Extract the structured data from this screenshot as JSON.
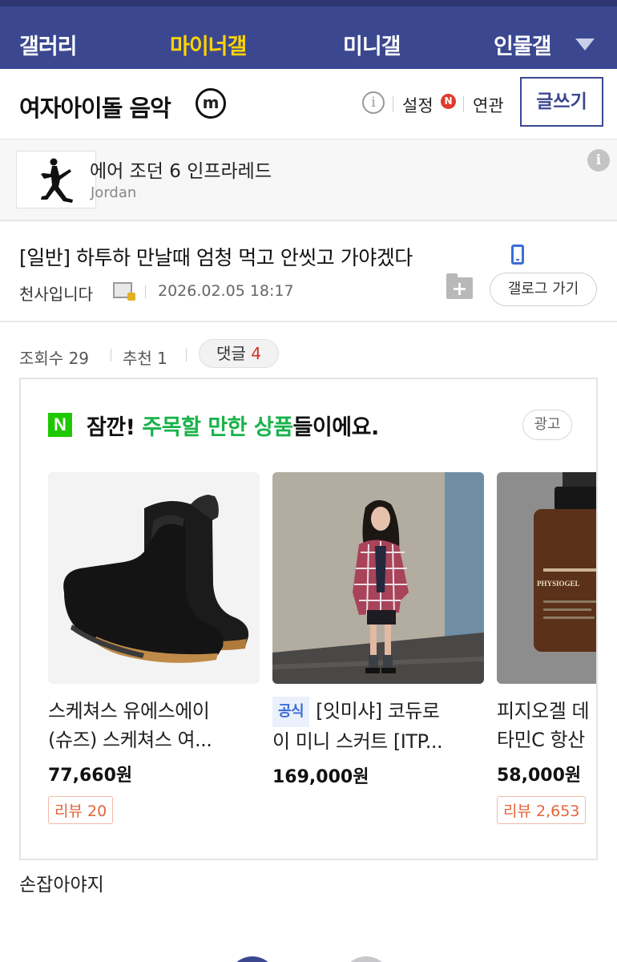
{
  "nav": {
    "tabs": [
      {
        "label": "갤러리"
      },
      {
        "label": "마이너갤"
      },
      {
        "label": "미니갤"
      },
      {
        "label": "인물갤"
      }
    ],
    "active_tab": "마이너갤"
  },
  "gallery": {
    "title": "여자아이돌 음악",
    "badge": "m",
    "info_glyph": "i",
    "settings_label": "설정",
    "settings_badge": "N",
    "related_label": "연관",
    "write_label": "글쓰기"
  },
  "ad_banner": {
    "title": "에어 조던 6 인프라레드",
    "brand": "Jordan",
    "info_glyph": "i"
  },
  "post": {
    "title": "[일반] 하투하 만날때 엄청 먹고 안씻고 가야겠다",
    "author": "천사입니다",
    "date": "2026.02.05 18:17",
    "folder_glyph": "+",
    "gallog_label": "갤로그 가기",
    "views_label": "조회수",
    "views": "29",
    "recommend_label": "추천",
    "recommend": "1",
    "comments_label": "댓글",
    "comments": "4",
    "body": "손잡아야지"
  },
  "product_ad": {
    "logo": "N",
    "headline_pre": "잠깐! ",
    "headline_highlight": "주목할 만한 상품",
    "headline_post": "들이에요.",
    "ad_label": "광고",
    "green": "#19b34a",
    "products": [
      {
        "line1": "스케쳐스 유에스에이",
        "line2": "(슈즈) 스케쳐스 여...",
        "price": "77,660원",
        "review": "리뷰 20"
      },
      {
        "tag": "공식",
        "line1": "[잇미샤] 코듀로",
        "line2": "이 미니 스커트 [ITP...",
        "price": "169,000원"
      },
      {
        "line1": "피지오겔 데",
        "line2": "타민C 항산",
        "price": "58,000원",
        "review": "리뷰 2,653",
        "image_text": "PHYSIOGEL"
      }
    ]
  },
  "colors": {
    "nav_bg": "#3b4890",
    "nav_active": "#ffd400",
    "accent_red": "#d0332a",
    "naver_green": "#1ec800"
  }
}
